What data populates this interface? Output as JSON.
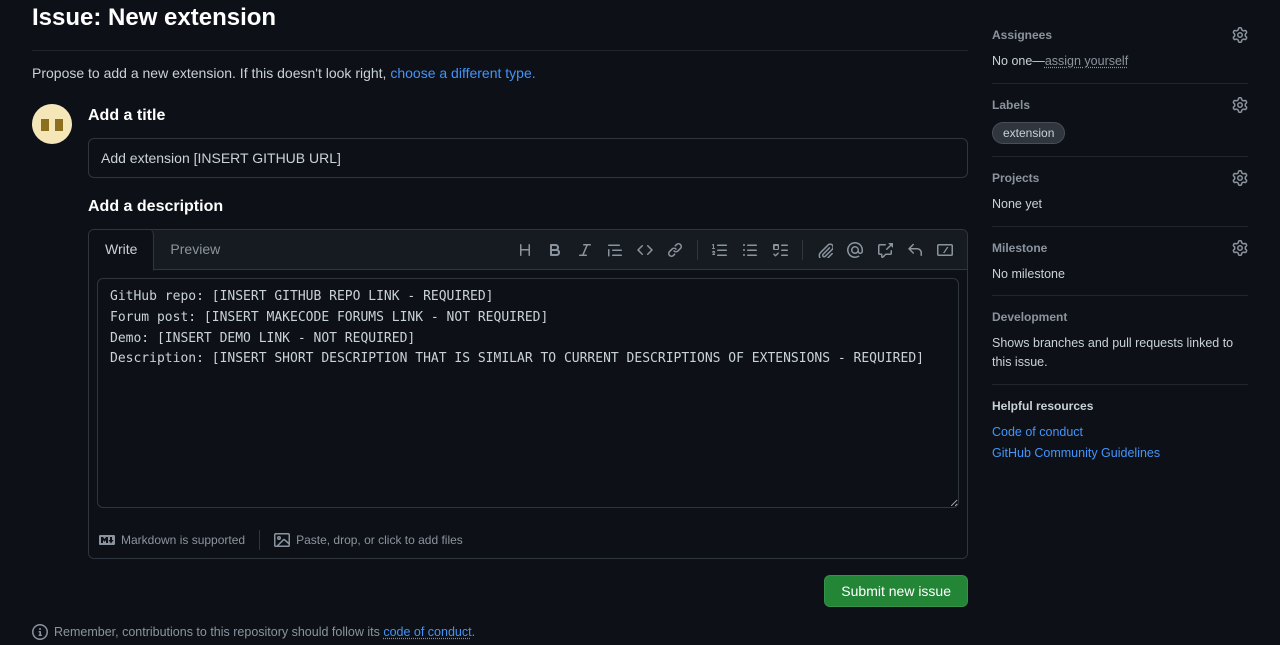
{
  "header": {
    "title": "Issue: New extension",
    "subdesc_prefix": "Propose to add a new extension. If this doesn't look right, ",
    "subdesc_link": "choose a different type."
  },
  "form": {
    "title_label": "Add a title",
    "title_value": "Add extension [INSERT GITHUB URL]",
    "desc_label": "Add a description",
    "tabs": {
      "write": "Write",
      "preview": "Preview"
    },
    "desc_value": "GitHub repo: [INSERT GITHUB REPO LINK - REQUIRED]\nForum post: [INSERT MAKECODE FORUMS LINK - NOT REQUIRED]\nDemo: [INSERT DEMO LINK - NOT REQUIRED]\nDescription: [INSERT SHORT DESCRIPTION THAT IS SIMILAR TO CURRENT DESCRIPTIONS OF EXTENSIONS - REQUIRED]",
    "markdown_note": "Markdown is supported",
    "attach_note": "Paste, drop, or click to add files",
    "submit_label": "Submit new issue",
    "remember_prefix": "Remember, contributions to this repository should follow its ",
    "code_of_conduct": "code of conduct"
  },
  "sidebar": {
    "assignees": {
      "title": "Assignees",
      "text_prefix": "No one—",
      "assign_link": "assign yourself"
    },
    "labels": {
      "title": "Labels",
      "items": [
        "extension"
      ]
    },
    "projects": {
      "title": "Projects",
      "text": "None yet"
    },
    "milestone": {
      "title": "Milestone",
      "text": "No milestone"
    },
    "development": {
      "title": "Development",
      "text": "Shows branches and pull requests linked to this issue."
    },
    "resources": {
      "title": "Helpful resources",
      "links": [
        "Code of conduct",
        "GitHub Community Guidelines"
      ]
    }
  }
}
